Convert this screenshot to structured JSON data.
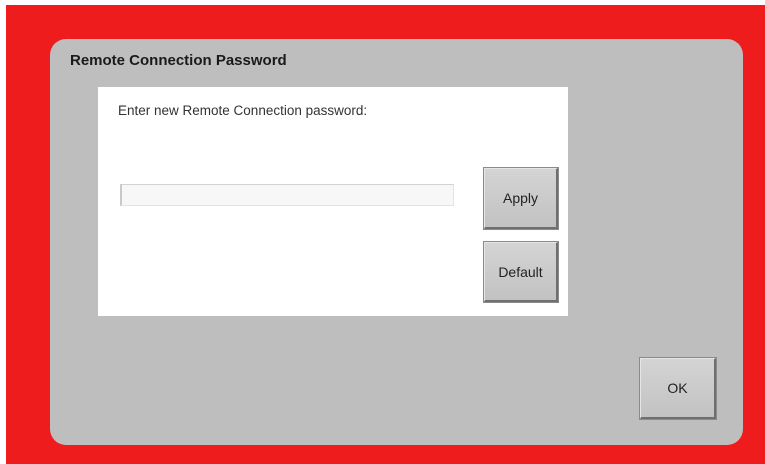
{
  "dialog": {
    "title": "Remote Connection Password",
    "prompt": "Enter new  Remote Connection password:",
    "password_value": "",
    "apply_label": "Apply",
    "default_label": "Default",
    "ok_label": "OK"
  },
  "colors": {
    "frame": "#ee1c1c",
    "dialog_background": "#bebebe",
    "panel_background": "#ffffff",
    "button_face": "#c8c8c8"
  }
}
